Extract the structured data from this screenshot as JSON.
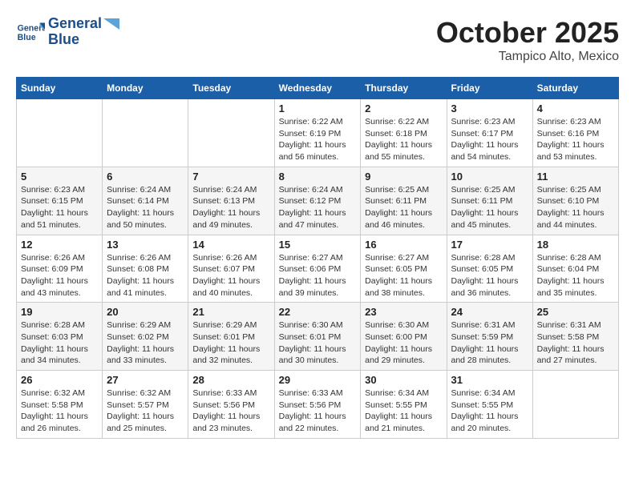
{
  "logo": {
    "line1": "General",
    "line2": "Blue"
  },
  "title": "October 2025",
  "location": "Tampico Alto, Mexico",
  "days_of_week": [
    "Sunday",
    "Monday",
    "Tuesday",
    "Wednesday",
    "Thursday",
    "Friday",
    "Saturday"
  ],
  "weeks": [
    [
      {
        "day": "",
        "info": ""
      },
      {
        "day": "",
        "info": ""
      },
      {
        "day": "",
        "info": ""
      },
      {
        "day": "1",
        "info": "Sunrise: 6:22 AM\nSunset: 6:19 PM\nDaylight: 11 hours and 56 minutes."
      },
      {
        "day": "2",
        "info": "Sunrise: 6:22 AM\nSunset: 6:18 PM\nDaylight: 11 hours and 55 minutes."
      },
      {
        "day": "3",
        "info": "Sunrise: 6:23 AM\nSunset: 6:17 PM\nDaylight: 11 hours and 54 minutes."
      },
      {
        "day": "4",
        "info": "Sunrise: 6:23 AM\nSunset: 6:16 PM\nDaylight: 11 hours and 53 minutes."
      }
    ],
    [
      {
        "day": "5",
        "info": "Sunrise: 6:23 AM\nSunset: 6:15 PM\nDaylight: 11 hours and 51 minutes."
      },
      {
        "day": "6",
        "info": "Sunrise: 6:24 AM\nSunset: 6:14 PM\nDaylight: 11 hours and 50 minutes."
      },
      {
        "day": "7",
        "info": "Sunrise: 6:24 AM\nSunset: 6:13 PM\nDaylight: 11 hours and 49 minutes."
      },
      {
        "day": "8",
        "info": "Sunrise: 6:24 AM\nSunset: 6:12 PM\nDaylight: 11 hours and 47 minutes."
      },
      {
        "day": "9",
        "info": "Sunrise: 6:25 AM\nSunset: 6:11 PM\nDaylight: 11 hours and 46 minutes."
      },
      {
        "day": "10",
        "info": "Sunrise: 6:25 AM\nSunset: 6:11 PM\nDaylight: 11 hours and 45 minutes."
      },
      {
        "day": "11",
        "info": "Sunrise: 6:25 AM\nSunset: 6:10 PM\nDaylight: 11 hours and 44 minutes."
      }
    ],
    [
      {
        "day": "12",
        "info": "Sunrise: 6:26 AM\nSunset: 6:09 PM\nDaylight: 11 hours and 43 minutes."
      },
      {
        "day": "13",
        "info": "Sunrise: 6:26 AM\nSunset: 6:08 PM\nDaylight: 11 hours and 41 minutes."
      },
      {
        "day": "14",
        "info": "Sunrise: 6:26 AM\nSunset: 6:07 PM\nDaylight: 11 hours and 40 minutes."
      },
      {
        "day": "15",
        "info": "Sunrise: 6:27 AM\nSunset: 6:06 PM\nDaylight: 11 hours and 39 minutes."
      },
      {
        "day": "16",
        "info": "Sunrise: 6:27 AM\nSunset: 6:05 PM\nDaylight: 11 hours and 38 minutes."
      },
      {
        "day": "17",
        "info": "Sunrise: 6:28 AM\nSunset: 6:05 PM\nDaylight: 11 hours and 36 minutes."
      },
      {
        "day": "18",
        "info": "Sunrise: 6:28 AM\nSunset: 6:04 PM\nDaylight: 11 hours and 35 minutes."
      }
    ],
    [
      {
        "day": "19",
        "info": "Sunrise: 6:28 AM\nSunset: 6:03 PM\nDaylight: 11 hours and 34 minutes."
      },
      {
        "day": "20",
        "info": "Sunrise: 6:29 AM\nSunset: 6:02 PM\nDaylight: 11 hours and 33 minutes."
      },
      {
        "day": "21",
        "info": "Sunrise: 6:29 AM\nSunset: 6:01 PM\nDaylight: 11 hours and 32 minutes."
      },
      {
        "day": "22",
        "info": "Sunrise: 6:30 AM\nSunset: 6:01 PM\nDaylight: 11 hours and 30 minutes."
      },
      {
        "day": "23",
        "info": "Sunrise: 6:30 AM\nSunset: 6:00 PM\nDaylight: 11 hours and 29 minutes."
      },
      {
        "day": "24",
        "info": "Sunrise: 6:31 AM\nSunset: 5:59 PM\nDaylight: 11 hours and 28 minutes."
      },
      {
        "day": "25",
        "info": "Sunrise: 6:31 AM\nSunset: 5:58 PM\nDaylight: 11 hours and 27 minutes."
      }
    ],
    [
      {
        "day": "26",
        "info": "Sunrise: 6:32 AM\nSunset: 5:58 PM\nDaylight: 11 hours and 26 minutes."
      },
      {
        "day": "27",
        "info": "Sunrise: 6:32 AM\nSunset: 5:57 PM\nDaylight: 11 hours and 25 minutes."
      },
      {
        "day": "28",
        "info": "Sunrise: 6:33 AM\nSunset: 5:56 PM\nDaylight: 11 hours and 23 minutes."
      },
      {
        "day": "29",
        "info": "Sunrise: 6:33 AM\nSunset: 5:56 PM\nDaylight: 11 hours and 22 minutes."
      },
      {
        "day": "30",
        "info": "Sunrise: 6:34 AM\nSunset: 5:55 PM\nDaylight: 11 hours and 21 minutes."
      },
      {
        "day": "31",
        "info": "Sunrise: 6:34 AM\nSunset: 5:55 PM\nDaylight: 11 hours and 20 minutes."
      },
      {
        "day": "",
        "info": ""
      }
    ]
  ]
}
